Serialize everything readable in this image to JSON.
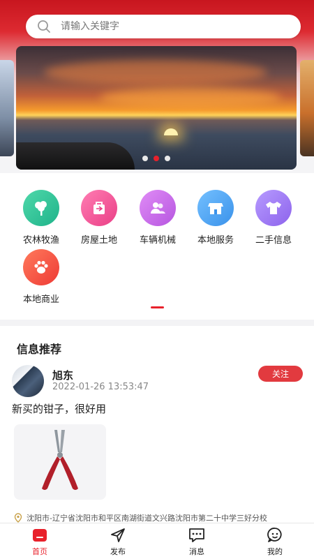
{
  "search": {
    "placeholder": "请输入关键字"
  },
  "banner": {
    "slide_count": 3,
    "active_index": 1
  },
  "categories": [
    {
      "label": "农林牧渔",
      "icon": "tree-icon",
      "color": "#2fc59b"
    },
    {
      "label": "房屋土地",
      "icon": "house-bag-icon",
      "color": "#f05a9c"
    },
    {
      "label": "车辆机械",
      "icon": "people-icon",
      "color": "#c86fe6"
    },
    {
      "label": "本地服务",
      "icon": "store-icon",
      "color": "#4aa4f2"
    },
    {
      "label": "二手信息",
      "icon": "shirt-icon",
      "color": "#a07af0"
    },
    {
      "label": "本地商业",
      "icon": "paw-icon",
      "color": "#f5533f"
    }
  ],
  "feed": {
    "title": "信息推荐",
    "post": {
      "user": "旭东",
      "time": "2022-01-26 13:53:47",
      "follow_label": "关注",
      "text": "新买的钳子，很好用",
      "location": "沈阳市-辽宁省沈阳市和平区南湖街道文兴路沈阳市第二十中学三好分校"
    }
  },
  "tabbar": [
    {
      "label": "首页",
      "icon": "home-icon",
      "active": true
    },
    {
      "label": "发布",
      "icon": "send-icon",
      "active": false
    },
    {
      "label": "消息",
      "icon": "message-icon",
      "active": false
    },
    {
      "label": "我的",
      "icon": "user-smile-icon",
      "active": false
    }
  ],
  "colors": {
    "accent": "#e8212b",
    "header_red": "#c8161f"
  }
}
